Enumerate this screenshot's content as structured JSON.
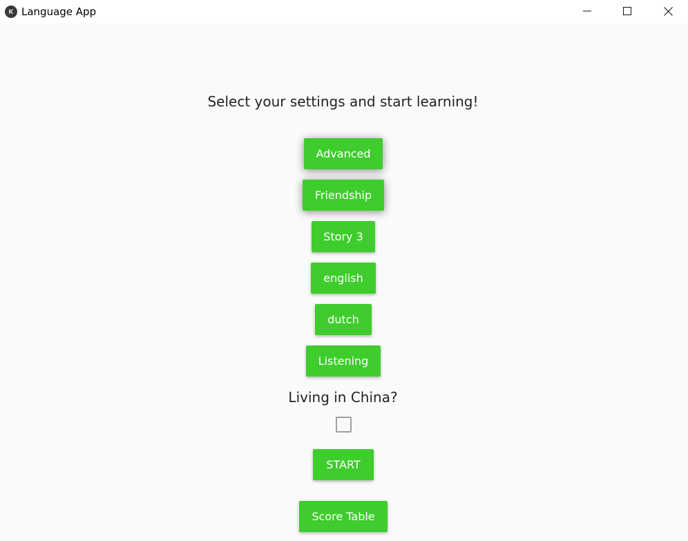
{
  "window": {
    "title": "Language App",
    "icon_label": "K"
  },
  "heading": "Select your settings and start learning!",
  "buttons": {
    "level": "Advanced",
    "topic": "Friendship",
    "story": "Story 3",
    "from_language": "english",
    "to_language": "dutch",
    "mode": "Listening",
    "start": "START",
    "score_table": "Score Table"
  },
  "living_in_china": {
    "label": "Living in China?",
    "checked": false
  },
  "colors": {
    "button_green": "#3ecd2c",
    "background": "#fafafa",
    "text": "#222222"
  }
}
